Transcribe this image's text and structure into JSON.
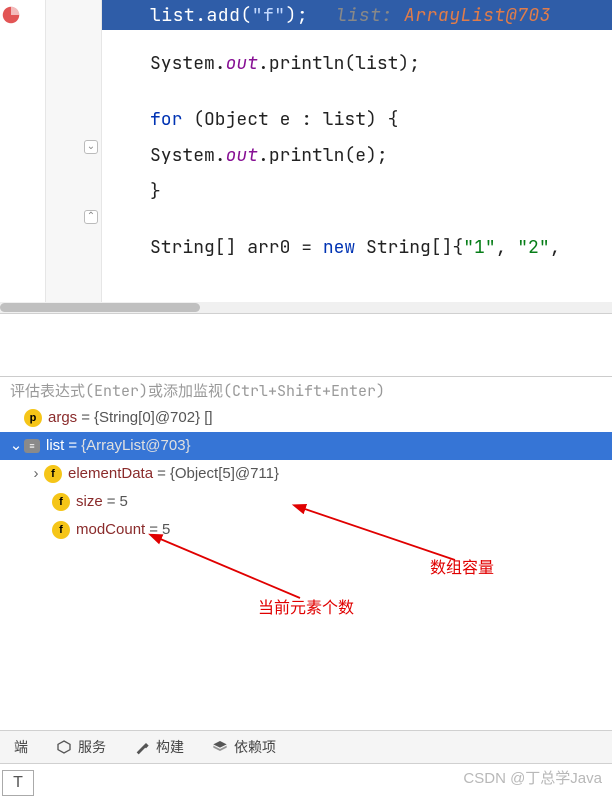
{
  "editor": {
    "hl_line": {
      "pre": "list.add(",
      "str": "\"f\"",
      "post": ");",
      "cmt_label": "list:",
      "cmt_val": " ArrayList@703"
    },
    "line2": {
      "a": "System.",
      "b": "out",
      "c": ".println(list);"
    },
    "line3": {
      "a": "for",
      "b": " (Object e : list) {"
    },
    "line4": {
      "a": "    System.",
      "b": "out",
      "c": ".println(e);"
    },
    "line5": "}",
    "line6": {
      "a": "String[] arr0 = ",
      "b": "new",
      "c": " String[]{",
      "s1": "\"1\"",
      "d": ", ",
      "s2": "\"2\"",
      "e": ","
    }
  },
  "eval_placeholder": "评估表达式(Enter)或添加监视(Ctrl+Shift+Enter)",
  "vars": {
    "args": {
      "name": "args",
      "val": "{String[0]@702} []"
    },
    "list": {
      "name": "list",
      "val": "{ArrayList@703}"
    },
    "elementData": {
      "name": "elementData",
      "val": "{Object[5]@711}"
    },
    "size": {
      "name": "size",
      "val": "5"
    },
    "modCount": {
      "name": "modCount",
      "val": "5"
    }
  },
  "annot": {
    "capacity": "数组容量",
    "count": "当前元素个数"
  },
  "toolbar": {
    "tab0": "端",
    "services": "服务",
    "build": "构建",
    "deps": "依赖项"
  },
  "watermark": "CSDN @丁总学Java",
  "filetag": "T",
  "icons": {
    "p": "p",
    "f": "f",
    "e": "≡"
  }
}
